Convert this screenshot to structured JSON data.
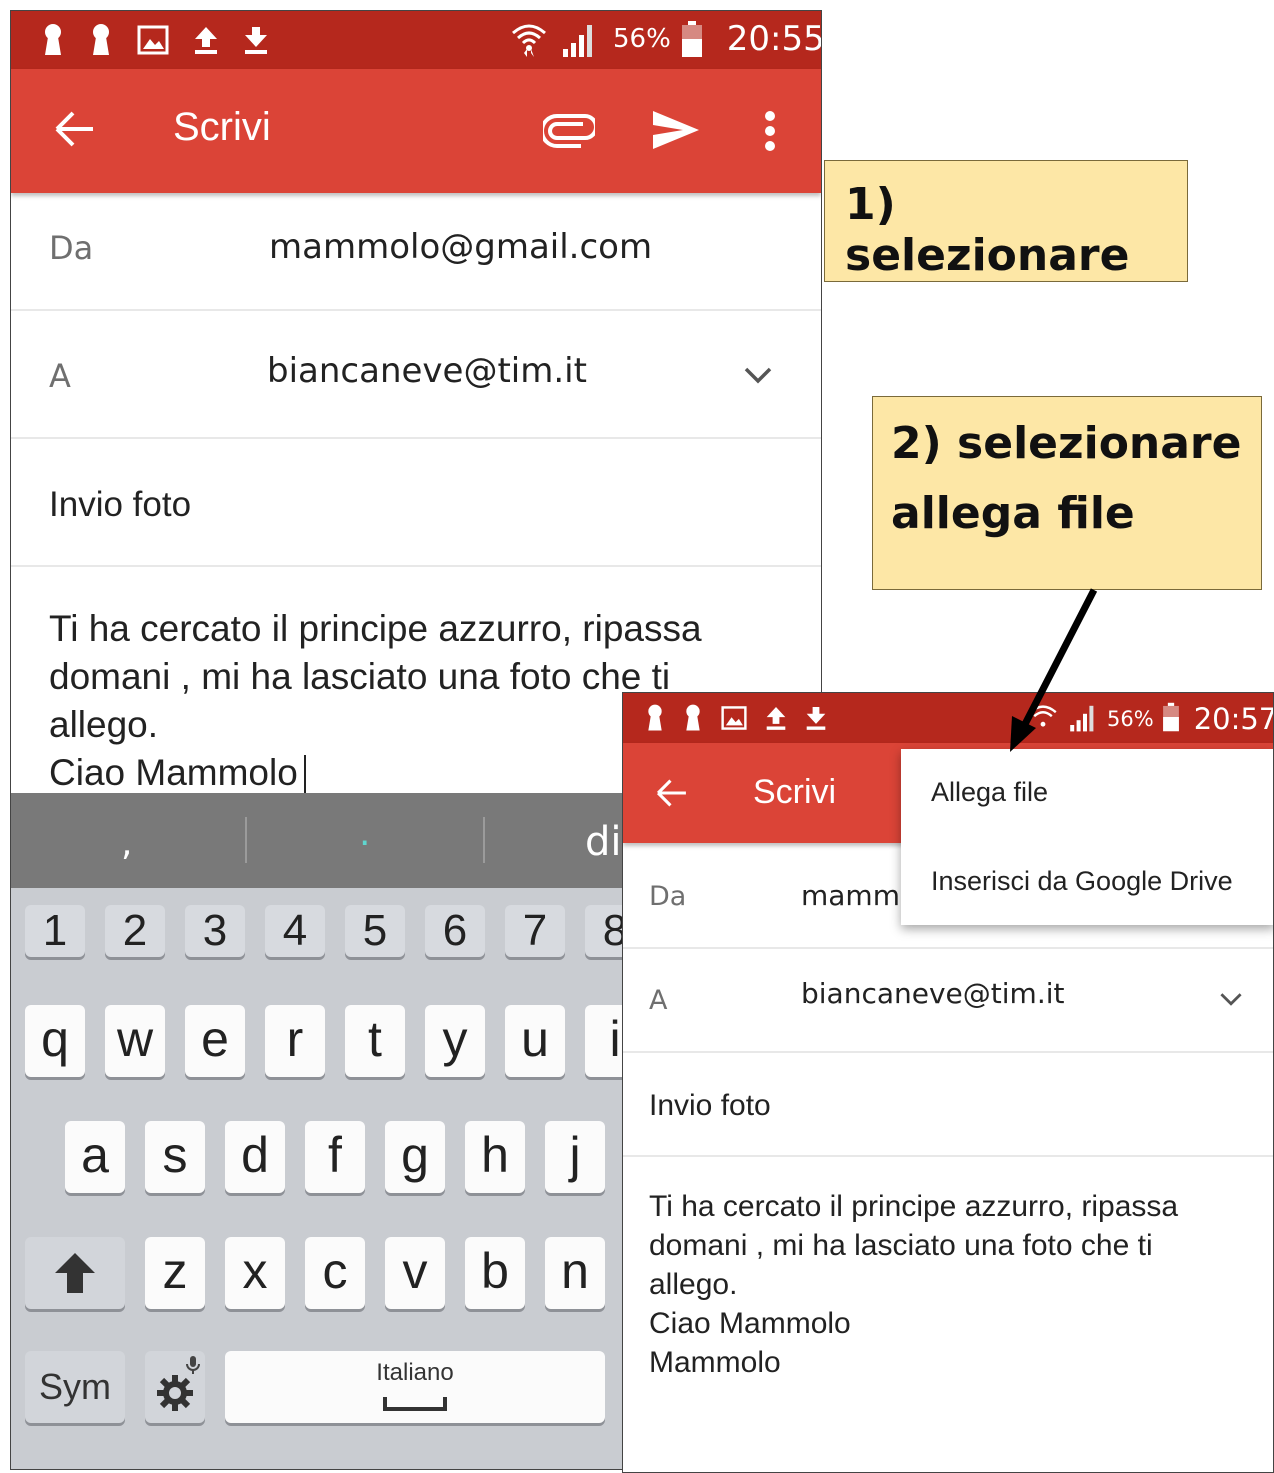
{
  "screen1": {
    "status": {
      "battery": "56%",
      "time": "20:55"
    },
    "appbar": {
      "title": "Scrivi",
      "back_icon": "arrow-left-icon",
      "attach_icon": "paperclip-icon",
      "send_icon": "send-icon",
      "more_icon": "more-vert-icon"
    },
    "from": {
      "label": "Da",
      "value": "mammolo@gmail.com"
    },
    "to": {
      "label": "A",
      "value": "biancaneve@tim.it"
    },
    "subject": "Invio foto",
    "body": [
      "Ti ha cercato il principe azzurro, ripassa",
      "domani , mi ha lasciato una foto che ti",
      "allego.",
      "Ciao Mammolo"
    ],
    "keyboard": {
      "suggestions": [
        ",",
        ".",
        "di"
      ],
      "numbers": [
        "1",
        "2",
        "3",
        "4",
        "5",
        "6",
        "7",
        "8"
      ],
      "row1": [
        "q",
        "w",
        "e",
        "r",
        "t",
        "y",
        "u",
        "i"
      ],
      "row2": [
        "a",
        "s",
        "d",
        "f",
        "g",
        "h",
        "j"
      ],
      "row3": [
        "z",
        "x",
        "c",
        "v",
        "b",
        "n"
      ],
      "sym": "Sym",
      "space": "Italiano"
    }
  },
  "screen2": {
    "status": {
      "battery": "56%",
      "time": "20:57"
    },
    "appbar": {
      "title": "Scrivi"
    },
    "from": {
      "label": "Da",
      "value": "mamm"
    },
    "to": {
      "label": "A",
      "value": "biancaneve@tim.it"
    },
    "subject": "Invio foto",
    "body": [
      "Ti ha cercato il principe azzurro, ripassa",
      "domani , mi ha lasciato una foto che ti",
      "allego.",
      "Ciao Mammolo",
      "Mammolo"
    ],
    "menu": [
      "Allega file",
      "Inserisci da Google Drive"
    ]
  },
  "callouts": {
    "step1": "1) selezionare",
    "step2": [
      "2) selezionare",
      "allega file"
    ]
  },
  "colors": {
    "appbar": "#db4437",
    "statusbar": "#b5281d",
    "callout_bg": "#fde7a6"
  }
}
